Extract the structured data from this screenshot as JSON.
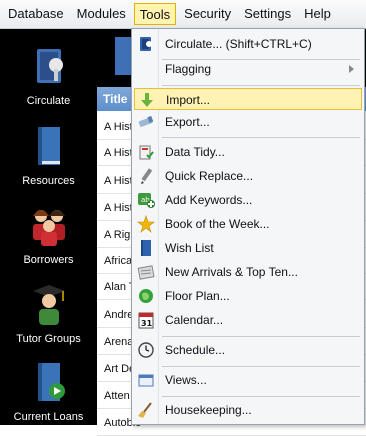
{
  "menubar": {
    "items": [
      "Database",
      "Modules",
      "Tools",
      "Security",
      "Settings",
      "Help"
    ],
    "active": "Tools"
  },
  "leftnav": {
    "items": [
      {
        "label": "Circulate",
        "icon": "circulate-icon"
      },
      {
        "label": "Resources",
        "icon": "book-icon"
      },
      {
        "label": "Borrowers",
        "icon": "people-icon"
      },
      {
        "label": "Tutor Groups",
        "icon": "graduate-icon"
      },
      {
        "label": "Current Loans",
        "icon": "book-arrow-icon"
      }
    ]
  },
  "table": {
    "header": "Title",
    "rows": [
      "A Hist",
      "A Hist",
      "A Hist",
      "A Hist",
      "A Rig",
      "Africa",
      "Alan T",
      "Andre",
      "Arena",
      "Art De",
      "Atten",
      "Autobio"
    ]
  },
  "tools_menu": {
    "items": [
      {
        "label": "Circulate...  (Shift+CTRL+C)",
        "icon": "circulate-icon"
      },
      {
        "label": "Flagging",
        "icon": "",
        "submenu": true
      },
      {
        "label": "Import...",
        "icon": "import-arrow-icon",
        "highlighted": true
      },
      {
        "label": "Export...",
        "icon": "export-icon"
      },
      {
        "label": "Data Tidy...",
        "icon": "data-tidy-icon"
      },
      {
        "label": "Quick Replace...",
        "icon": "pencil-icon"
      },
      {
        "label": "Add Keywords...",
        "icon": "keywords-icon"
      },
      {
        "label": "Book of the Week...",
        "icon": "star-icon"
      },
      {
        "label": "Wish List",
        "icon": "wish-list-book-icon"
      },
      {
        "label": "New Arrivals & Top Ten...",
        "icon": "new-arrivals-icon"
      },
      {
        "label": "Floor Plan...",
        "icon": "floor-plan-globe-icon"
      },
      {
        "label": "Calendar...",
        "icon": "calendar-icon",
        "calendar_day": "31"
      },
      {
        "label": "Schedule...",
        "icon": "clock-icon"
      },
      {
        "label": "Views...",
        "icon": "views-icon"
      },
      {
        "label": "Housekeeping...",
        "icon": "broom-icon"
      }
    ]
  }
}
